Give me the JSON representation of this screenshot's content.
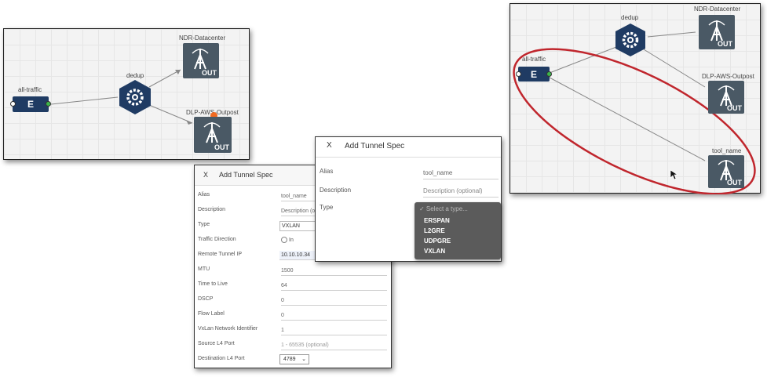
{
  "canvas_left": {
    "nodes": {
      "source": {
        "label": "all-traffic",
        "glyph": "E"
      },
      "dedup": {
        "label": "dedup"
      },
      "tool1": {
        "label": "NDR-Datacenter",
        "tag": "OUT"
      },
      "tool2": {
        "label": "DLP-AWS-Outpost",
        "tag": "OUT"
      }
    }
  },
  "canvas_right": {
    "nodes": {
      "source": {
        "label": "all-traffic",
        "glyph": "E"
      },
      "dedup": {
        "label": "dedup"
      },
      "tool1": {
        "label": "NDR-Datacenter",
        "tag": "OUT"
      },
      "tool2": {
        "label": "DLP-AWS-Outpost",
        "tag": "OUT"
      },
      "tool3": {
        "label": "tool_name",
        "tag": "OUT"
      }
    },
    "highlight_color": "#c0262d"
  },
  "dialog_large": {
    "close": "X",
    "title": "Add Tunnel Spec",
    "fields": [
      {
        "label": "Alias",
        "value": "tool_name"
      },
      {
        "label": "Description",
        "value": "Description (optional)"
      },
      {
        "label": "Type",
        "value": "VXLAN"
      },
      {
        "label": "Traffic Direction",
        "value": "In"
      },
      {
        "label": "Remote Tunnel IP",
        "value": "10.10.10.34"
      },
      {
        "label": "MTU",
        "value": "1500"
      },
      {
        "label": "Time to Live",
        "value": "64"
      },
      {
        "label": "DSCP",
        "value": "0"
      },
      {
        "label": "Flow Label",
        "value": "0"
      },
      {
        "label": "VxLan Network Identifier",
        "value": "1"
      },
      {
        "label": "Source L4 Port",
        "value": "1 - 65535 (optional)"
      },
      {
        "label": "Destination L4 Port",
        "value": "4789"
      }
    ]
  },
  "dialog_small": {
    "close": "X",
    "title": "Add Tunnel Spec",
    "fields": [
      {
        "label": "Alias",
        "value": "tool_name"
      },
      {
        "label": "Description",
        "value": "Description (optional)"
      },
      {
        "label": "Type",
        "value": ""
      }
    ],
    "dropdown": {
      "placeholder": "✓ Select a type...",
      "options": [
        "ERSPAN",
        "L2GRE",
        "UDPGRE",
        "VXLAN"
      ]
    }
  },
  "colors": {
    "source_node": "#1f3b63",
    "tool_node": "#4a5965",
    "dedup_node": "#1f3b63",
    "port_green": "#3bb54a",
    "accent_orange": "#f26a21"
  }
}
